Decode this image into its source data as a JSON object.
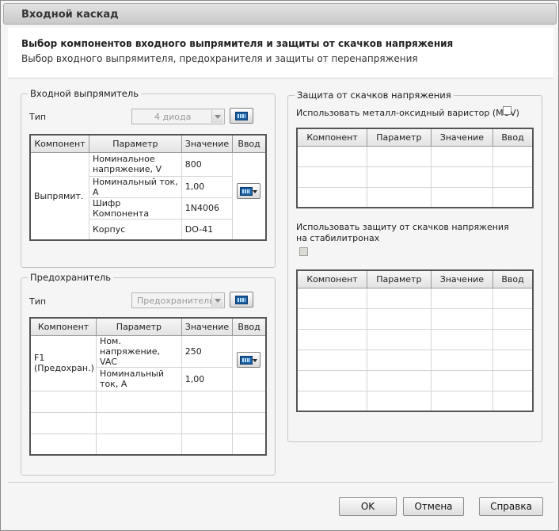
{
  "window": {
    "title": "Входной каскад"
  },
  "header": {
    "title": "Выбор компонентов входного выпрямителя и защиты от скачков напряжения",
    "subtitle": "Выбор входного выпрямителя, предохранителя и защиты от перенапряжения"
  },
  "rectifier": {
    "group_title": "Входной выпрямитель",
    "type_label": "Тип",
    "type_value": "4 диода",
    "columns": [
      "Компонент",
      "Параметр",
      "Значение",
      "Ввод"
    ],
    "component": "Выпрямит.",
    "rows": [
      {
        "param": "Номинальное напряжение, V",
        "value": "800"
      },
      {
        "param": "Номинальный ток, A",
        "value": "1,00"
      },
      {
        "param": "Шифр Компонента",
        "value": "1N4006"
      },
      {
        "param": "Корпус",
        "value": "DO-41"
      }
    ]
  },
  "fuse": {
    "group_title": "Предохранитель",
    "type_label": "Тип",
    "type_value": "Предохранитель",
    "columns": [
      "Компонент",
      "Параметр",
      "Значение",
      "Ввод"
    ],
    "component": "F1 (Предохран.)",
    "rows": [
      {
        "param": "Ном. напряжение, VAC",
        "value": "250"
      },
      {
        "param": "Номинальный ток, A",
        "value": "1,00"
      }
    ]
  },
  "surge": {
    "group_title": "Защита от скачков напряжения",
    "mov_label": "Использовать металл-оксидный варистор (MOV)",
    "zener_label": "Использовать защиту от скачков напряжения на стабилитронах",
    "columns": [
      "Компонент",
      "Параметр",
      "Значение",
      "Ввод"
    ]
  },
  "buttons": {
    "ok": "OK",
    "cancel": "Отмена",
    "help": "Справка"
  }
}
